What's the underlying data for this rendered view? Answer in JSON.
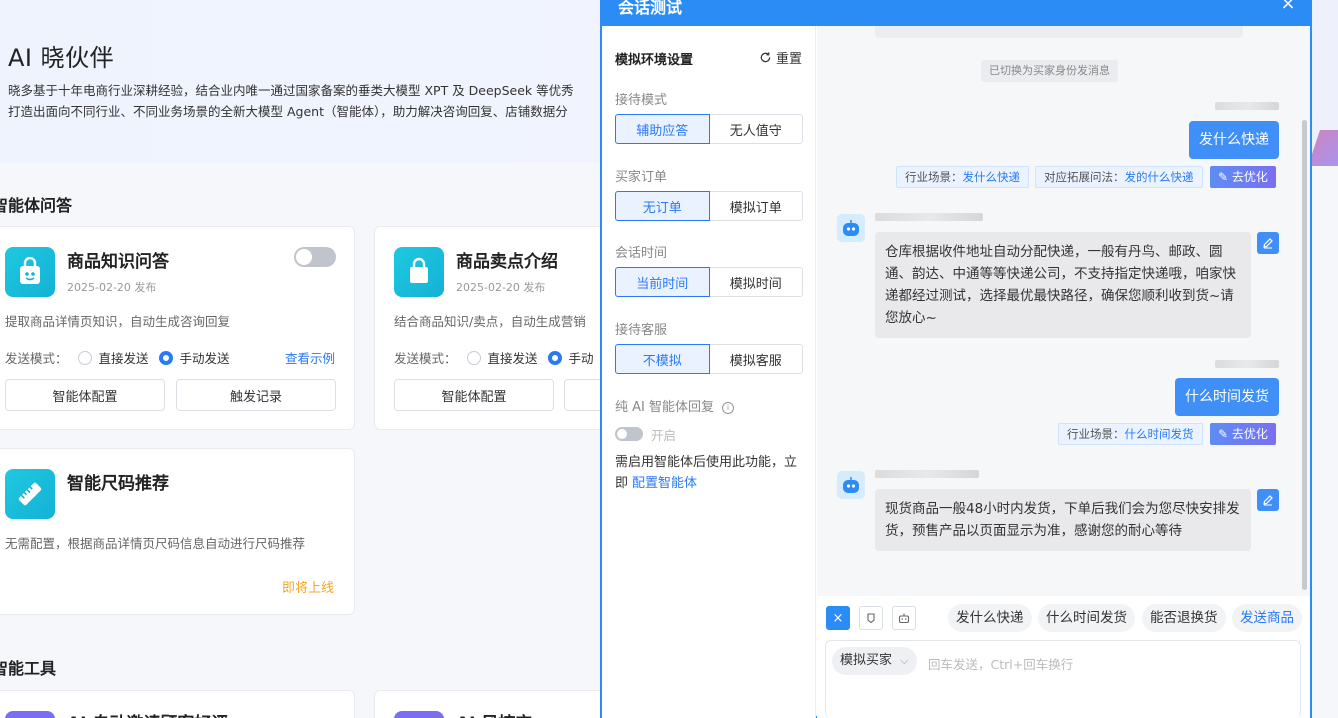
{
  "hero": {
    "title": "AI 晓伙伴",
    "desc_line1": "晓多基于十年电商行业深耕经验，结合业内唯一通过国家备案的垂类大模型 XPT 及 DeepSeek 等优秀",
    "desc_line2": "打造出面向不同行业、不同业务场景的全新大模型 Agent（智能体），助力解决咨询回复、店铺数据分"
  },
  "sections": {
    "agents_title": "智能体问答",
    "tools_title": "智能工具"
  },
  "cards": [
    {
      "name": "商品知识问答",
      "date": "2025-02-20 发布",
      "desc": "提取商品详情页知识，自动生成咨询回复",
      "send_mode_label": "发送模式：",
      "option_direct": "直接发送",
      "option_manual": "手动发送",
      "selected": "手动发送",
      "example_link": "查看示例",
      "config_button": "智能体配置",
      "records_button": "触发记录"
    },
    {
      "name": "商品卖点介绍",
      "date": "2025-02-20 发布",
      "desc": "结合商品知识/卖点，自动生成营销",
      "send_mode_label": "发送模式：",
      "option_direct": "直接发送",
      "option_manual": "手动",
      "selected": "手动",
      "config_button": "智能体配置"
    },
    {
      "name": "智能尺码推荐",
      "desc": "无需配置，根据商品详情页尺码信息自动进行尺码推荐",
      "status": "即将上线"
    }
  ],
  "tool_cards": [
    {
      "name": "AI 自动邀请顾客好评"
    },
    {
      "name": "AI 风控宝"
    }
  ],
  "modal": {
    "title": "会话测试",
    "close": "×",
    "settings": {
      "title": "模拟环境设置",
      "reset": "重置",
      "reception_mode": {
        "label": "接待模式",
        "options": [
          "辅助应答",
          "无人值守"
        ],
        "active": 0
      },
      "buyer_order": {
        "label": "买家订单",
        "options": [
          "无订单",
          "模拟订单"
        ],
        "active": 0
      },
      "session_time": {
        "label": "会话时间",
        "options": [
          "当前时间",
          "模拟时间"
        ],
        "active": 0
      },
      "reception_cs": {
        "label": "接待客服",
        "options": [
          "不模拟",
          "模拟客服"
        ],
        "active": 0
      },
      "pure_ai_label": "纯 AI 智能体回复",
      "pure_ai_toggle_label": "开启",
      "pure_ai_enabled": false,
      "note_prefix": "需启用智能体后使用此功能，立即",
      "note_link": "配置智能体"
    },
    "chat": {
      "system_message": "已切换为买家身份发消息",
      "messages": [
        {
          "from": "buyer",
          "text": "发什么快递",
          "tags": [
            {
              "label": "行业场景：",
              "value": "发什么快递"
            },
            {
              "label": "对应拓展问法：",
              "value": "发的什么快递"
            }
          ],
          "optimize": "去优化"
        },
        {
          "from": "bot",
          "text": "仓库根据收件地址自动分配快递，一般有丹鸟、邮政、圆通、韵达、中通等等快递公司，不支持指定快递哦，咱家快递都经过测试，选择最优最快路径，确保您顺利收到货~请您放心~"
        },
        {
          "from": "buyer",
          "text": "什么时间发货",
          "tags": [
            {
              "label": "行业场景：",
              "value": "什么时间发货"
            }
          ],
          "optimize": "去优化"
        },
        {
          "from": "bot",
          "text": "现货商品一般48小时内发货，下单后我们会为您尽快安排发货，预售产品以页面显示为准，感谢您的耐心等待"
        }
      ]
    },
    "composer": {
      "quick_replies": [
        "发什么快递",
        "什么时间发货",
        "能否退换货"
      ],
      "send_product": "发送商品",
      "role": "模拟买家",
      "placeholder": "回车发送，Ctrl+回车换行"
    }
  },
  "colors": {
    "primary": "#2a8cf4",
    "link": "#2a7af5",
    "coming_soon": "#f5a623",
    "agent_icon": "#1ec9df"
  }
}
